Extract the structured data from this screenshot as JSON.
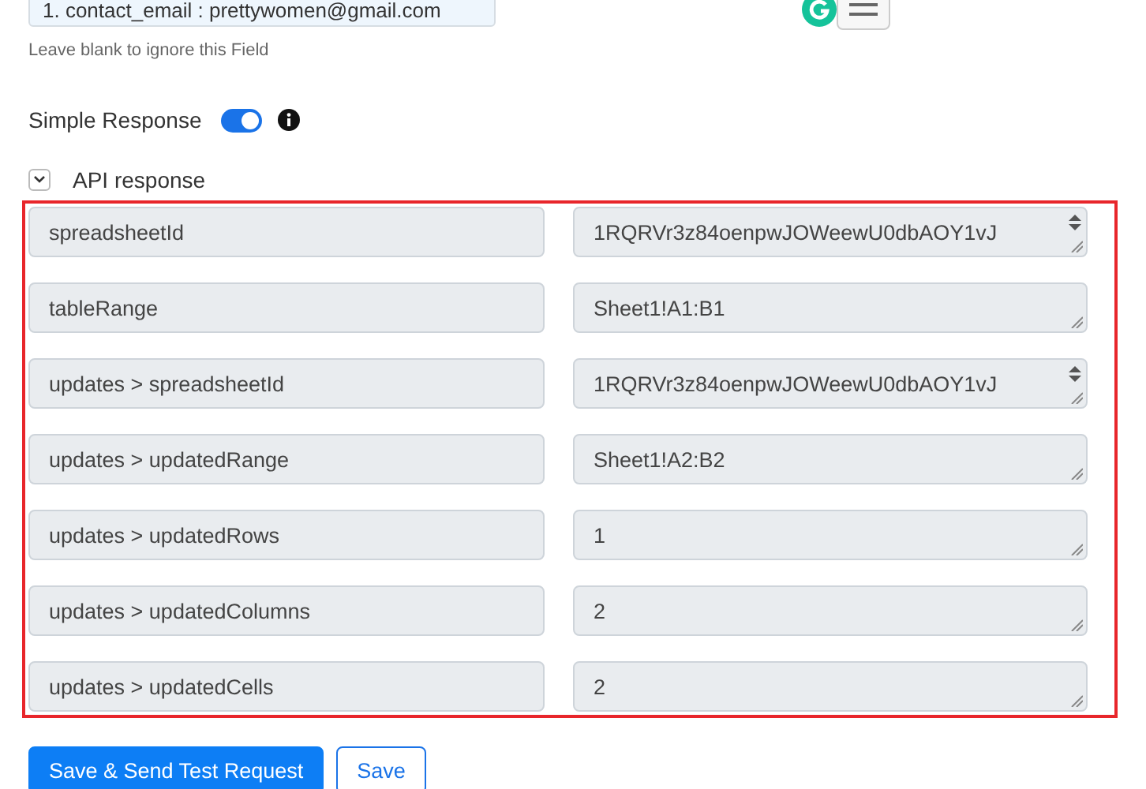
{
  "top_field": {
    "value": "1. contact_email : prettywomen@gmail.com",
    "hint": "Leave blank to ignore this Field"
  },
  "simple_response": {
    "label": "Simple Response",
    "on": true
  },
  "api_response": {
    "label": "API response",
    "expanded": true,
    "rows": [
      {
        "key": "spreadsheetId",
        "value": "1RQRVr3z84oenpwJOWeewU0dbAOY1vJ",
        "scrollable": true
      },
      {
        "key": "tableRange",
        "value": "Sheet1!A1:B1",
        "scrollable": false
      },
      {
        "key": "updates > spreadsheetId",
        "value": "1RQRVr3z84oenpwJOWeewU0dbAOY1vJ",
        "scrollable": true
      },
      {
        "key": "updates > updatedRange",
        "value": "Sheet1!A2:B2",
        "scrollable": false
      },
      {
        "key": "updates > updatedRows",
        "value": "1",
        "scrollable": false
      },
      {
        "key": "updates > updatedColumns",
        "value": "2",
        "scrollable": false
      },
      {
        "key": "updates > updatedCells",
        "value": "2",
        "scrollable": false
      }
    ]
  },
  "buttons": [
    {
      "label": "Save & Send Test Request",
      "kind": "primary"
    },
    {
      "label": "Save",
      "kind": "outline"
    }
  ]
}
